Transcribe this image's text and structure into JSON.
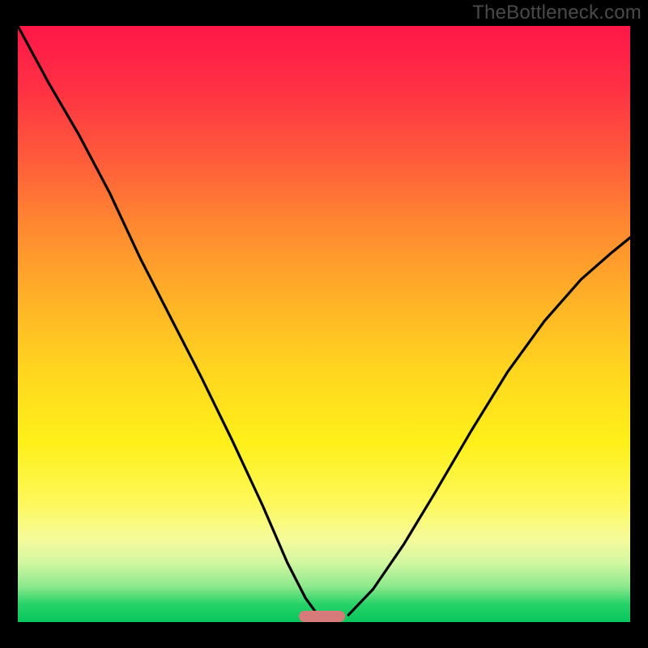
{
  "watermark": "TheBottleneck.com",
  "plot": {
    "gradient_stops": [
      {
        "pct": 0,
        "color": "#ff1748"
      },
      {
        "pct": 10,
        "color": "#ff2f44"
      },
      {
        "pct": 22,
        "color": "#ff5a3b"
      },
      {
        "pct": 34,
        "color": "#ff8a30"
      },
      {
        "pct": 46,
        "color": "#ffb227"
      },
      {
        "pct": 58,
        "color": "#ffd61e"
      },
      {
        "pct": 70,
        "color": "#fff01a"
      },
      {
        "pct": 80,
        "color": "#fdf85a"
      },
      {
        "pct": 86,
        "color": "#f6fb9b"
      },
      {
        "pct": 90,
        "color": "#d2f7a1"
      },
      {
        "pct": 94,
        "color": "#8de98c"
      },
      {
        "pct": 97,
        "color": "#27d368"
      },
      {
        "pct": 100,
        "color": "#07c65d"
      }
    ],
    "marker": {
      "x_norm": 0.497,
      "width_norm": 0.075,
      "color": "#d77b7a"
    },
    "border_color": "#000000"
  },
  "chart_data": {
    "type": "line",
    "title": "",
    "xlabel": "",
    "ylabel": "",
    "xlim": [
      0,
      1
    ],
    "ylim": [
      0,
      1
    ],
    "note": "No axis tick labels are rendered in the source image; x/y are normalized to the plot area.",
    "series": [
      {
        "name": "left-curve",
        "x": [
          0.0,
          0.05,
          0.1,
          0.15,
          0.2,
          0.25,
          0.3,
          0.35,
          0.4,
          0.44,
          0.47,
          0.49
        ],
        "y": [
          1.0,
          0.905,
          0.817,
          0.72,
          0.61,
          0.51,
          0.41,
          0.305,
          0.195,
          0.1,
          0.04,
          0.012
        ]
      },
      {
        "name": "right-curve",
        "x": [
          0.54,
          0.58,
          0.63,
          0.68,
          0.74,
          0.8,
          0.86,
          0.92,
          0.97,
          1.0
        ],
        "y": [
          0.012,
          0.055,
          0.13,
          0.215,
          0.32,
          0.42,
          0.505,
          0.575,
          0.62,
          0.645
        ]
      }
    ],
    "marker_band": {
      "x_start": 0.46,
      "x_end": 0.535,
      "y": 0.006
    }
  }
}
